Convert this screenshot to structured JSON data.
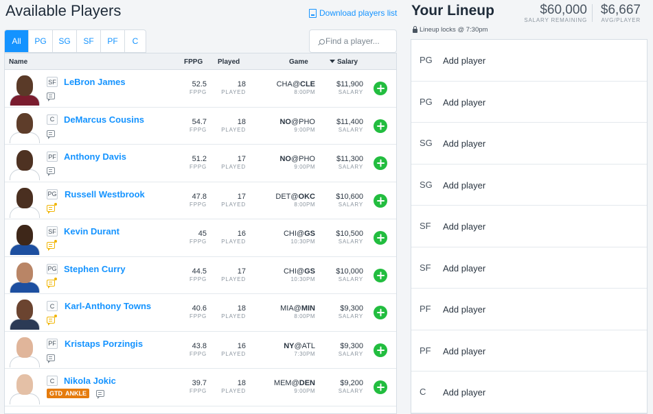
{
  "left": {
    "title": "Available Players",
    "download_label": "Download players list",
    "tabs": [
      "All",
      "PG",
      "SG",
      "SF",
      "PF",
      "C"
    ],
    "search_placeholder": "Find a player...",
    "headers": {
      "name": "Name",
      "fppg": "FPPG",
      "played": "Played",
      "game": "Game",
      "salary": "Salary"
    },
    "fppg_label": "FPPG",
    "played_label": "PLAYED",
    "salary_label": "SALARY",
    "players": [
      {
        "pos": "SF",
        "name": "LeBron James",
        "fppg": "52.5",
        "played": "18",
        "away": "CHA",
        "at": "@",
        "home": "CLE",
        "bold": "home",
        "time": "8:00PM",
        "salary": "$11,900",
        "note": "plain",
        "skin": "#5a3a28",
        "jersey": "#7a1c2e"
      },
      {
        "pos": "C",
        "name": "DeMarcus Cousins",
        "fppg": "54.7",
        "played": "18",
        "away": "NO",
        "at": "@",
        "home": "PHO",
        "bold": "away",
        "time": "9:00PM",
        "salary": "$11,400",
        "note": "plain",
        "skin": "#5e3d2a",
        "jersey": "#ffffff"
      },
      {
        "pos": "PF",
        "name": "Anthony Davis",
        "fppg": "51.2",
        "played": "17",
        "away": "NO",
        "at": "@",
        "home": "PHO",
        "bold": "away",
        "time": "9:00PM",
        "salary": "$11,300",
        "note": "plain",
        "skin": "#4e3222",
        "jersey": "#ffffff"
      },
      {
        "pos": "PG",
        "name": "Russell Westbrook",
        "fppg": "47.8",
        "played": "17",
        "away": "DET",
        "at": "@",
        "home": "OKC",
        "bold": "home",
        "time": "8:00PM",
        "salary": "$10,600",
        "note": "new",
        "skin": "#4a2f20",
        "jersey": "#ffffff"
      },
      {
        "pos": "SF",
        "name": "Kevin Durant",
        "fppg": "45",
        "played": "16",
        "away": "CHI",
        "at": "@",
        "home": "GS",
        "bold": "home",
        "time": "10:30PM",
        "salary": "$10,500",
        "note": "new",
        "skin": "#3e2719",
        "jersey": "#1d4fa0"
      },
      {
        "pos": "PG",
        "name": "Stephen Curry",
        "fppg": "44.5",
        "played": "17",
        "away": "CHI",
        "at": "@",
        "home": "GS",
        "bold": "home",
        "time": "10:30PM",
        "salary": "$10,000",
        "note": "new",
        "skin": "#b98566",
        "jersey": "#1d4fa0"
      },
      {
        "pos": "C",
        "name": "Karl-Anthony Towns",
        "fppg": "40.6",
        "played": "18",
        "away": "MIA",
        "at": "@",
        "home": "MIN",
        "bold": "home",
        "time": "8:00PM",
        "salary": "$9,300",
        "note": "new",
        "skin": "#6b4430",
        "jersey": "#2b3a55"
      },
      {
        "pos": "PF",
        "name": "Kristaps Porzingis",
        "fppg": "43.8",
        "played": "16",
        "away": "NY",
        "at": "@",
        "home": "ATL",
        "bold": "away",
        "time": "7:30PM",
        "salary": "$9,300",
        "note": "plain",
        "skin": "#e0b59a",
        "jersey": "#ffffff"
      },
      {
        "pos": "C",
        "name": "Nikola Jokic",
        "fppg": "39.7",
        "played": "18",
        "away": "MEM",
        "at": "@",
        "home": "DEN",
        "bold": "home",
        "time": "9:00PM",
        "salary": "$9,200",
        "note": "plain",
        "skin": "#e4c0a6",
        "jersey": "#ffffff",
        "injury": {
          "status": "GTD",
          "detail": "ANKLE"
        }
      }
    ]
  },
  "right": {
    "title": "Your Lineup",
    "salary_remaining": "$60,000",
    "salary_remaining_label": "SALARY REMAINING",
    "avg_per_player": "$6,667",
    "avg_per_player_label": "AVG/PLAYER",
    "lock_text": "Lineup locks @ 7:30pm",
    "slots": [
      {
        "pos": "PG",
        "label": "Add player"
      },
      {
        "pos": "PG",
        "label": "Add player"
      },
      {
        "pos": "SG",
        "label": "Add player"
      },
      {
        "pos": "SG",
        "label": "Add player"
      },
      {
        "pos": "SF",
        "label": "Add player"
      },
      {
        "pos": "SF",
        "label": "Add player"
      },
      {
        "pos": "PF",
        "label": "Add player"
      },
      {
        "pos": "PF",
        "label": "Add player"
      },
      {
        "pos": "C",
        "label": "Add player"
      }
    ]
  },
  "colors": {
    "accent": "#1493ff",
    "add": "#22bd3f",
    "injury": "#e57b0d",
    "note_new": "#f0b400"
  }
}
